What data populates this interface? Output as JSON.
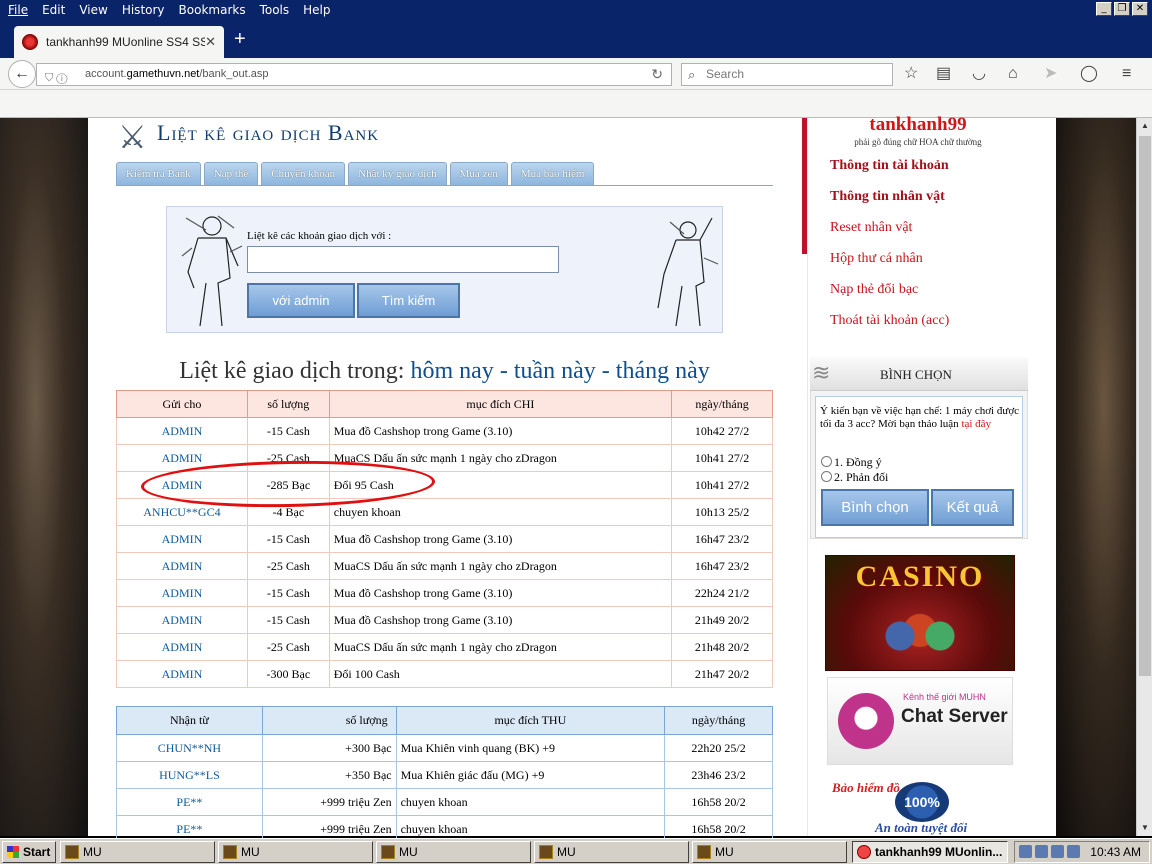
{
  "menubar": {
    "items": [
      "File",
      "Edit",
      "View",
      "History",
      "Bookmarks",
      "Tools",
      "Help"
    ]
  },
  "browser": {
    "tab_title": "tankhanh99 MUonline SS4 SS...",
    "url_prefix": "account.",
    "url_host": "gamethuvn.net",
    "url_path": "/bank_out.asp",
    "search_placeholder": "Search"
  },
  "page": {
    "title": "Liệt kê giao dịch Bank",
    "tabs": [
      "Kiểm tra Bank",
      "Nạp thẻ",
      "Chuyển khoản",
      "Nhật ký giao dịch",
      "Mua zen",
      "Mua bảo hiểm"
    ],
    "search_label": "Liệt kê các khoản giao dịch với :",
    "search_value": "",
    "btn_admin": "với admin",
    "btn_search": "Tìm kiếm",
    "list_heading_prefix": "Liệt kê giao dịch trong:",
    "list_today": "hôm nay",
    "list_week": "tuần này",
    "list_month": "tháng này",
    "sep": "-"
  },
  "chi_table": {
    "headers": [
      "Gửi cho",
      "số lượng",
      "mục đích CHI",
      "ngày/tháng"
    ],
    "rows": [
      [
        "ADMIN",
        "-15  Cash",
        "Mua đồ Cashshop trong Game (3.10)",
        "10h42 27/2"
      ],
      [
        "ADMIN",
        "-25  Cash",
        "MuaCS Dấu ấn sức mạnh 1 ngày cho zDragon",
        "10h41 27/2"
      ],
      [
        "ADMIN",
        "-285  Bạc",
        "Đổi 95 Cash",
        "10h41 27/2"
      ],
      [
        "ANHCU**GC4",
        "-4  Bạc",
        "chuyen khoan",
        "10h13 25/2"
      ],
      [
        "ADMIN",
        "-15  Cash",
        "Mua đồ Cashshop trong Game (3.10)",
        "16h47 23/2"
      ],
      [
        "ADMIN",
        "-25  Cash",
        "MuaCS Dấu ấn sức mạnh 1 ngày cho zDragon",
        "16h47 23/2"
      ],
      [
        "ADMIN",
        "-15  Cash",
        "Mua đồ Cashshop trong Game (3.10)",
        "22h24 21/2"
      ],
      [
        "ADMIN",
        "-15  Cash",
        "Mua đồ Cashshop trong Game (3.10)",
        "21h49 20/2"
      ],
      [
        "ADMIN",
        "-25  Cash",
        "MuaCS Dấu ấn sức mạnh 1 ngày cho zDragon",
        "21h48 20/2"
      ],
      [
        "ADMIN",
        "-300  Bạc",
        "Đổi 100 Cash",
        "21h47 20/2"
      ]
    ]
  },
  "thu_table": {
    "headers": [
      "Nhận từ",
      "số lượng",
      "mục đích THU",
      "ngày/tháng"
    ],
    "rows": [
      [
        "CHUN**NH",
        "+300  Bạc",
        "Mua Khiên vinh quang (BK) +9",
        "22h20 25/2"
      ],
      [
        "HUNG**LS",
        "+350  Bạc",
        "Mua Khiên giác đấu (MG) +9",
        "23h46 23/2"
      ],
      [
        "PE**",
        "+999  triệu Zen",
        "chuyen khoan",
        "16h58 20/2"
      ],
      [
        "PE**",
        "+999  triệu Zen",
        "chuyen khoan",
        "16h58 20/2"
      ]
    ]
  },
  "sidebar": {
    "username": "tankhanh99",
    "note": "phải gõ đúng chữ HOA chữ thường",
    "links": [
      "Thông tin tài khoản",
      "Thông tin nhân vật",
      "Reset nhân vật",
      "Hộp thư cá nhân",
      "Nạp thẻ đổi bạc",
      "Thoát tài khoản (acc)"
    ],
    "vote_title": "BÌNH CHỌN",
    "vote_question": "Ý kiến bạn về việc hạn chế: 1 máy chơi được tối đa 3 acc? Mời bạn thảo luận",
    "vote_link": "tại đây",
    "options": [
      "1. Đồng ý",
      "2. Phản đối"
    ],
    "btn_vote": "Bình chọn",
    "btn_result": "Kết quả",
    "ad_casino": "CASINO",
    "ad_chat_small": "Kênh thế giới MUHN",
    "ad_chat_big": "Chat Server",
    "ad_ins_top": "Bảo hiểm đồ",
    "ad_ins_seal": "100%",
    "ad_ins_bottom": "An toàn tuyệt đối"
  },
  "taskbar": {
    "start": "Start",
    "buttons": [
      "MU",
      "MU",
      "MU",
      "MU",
      "MU",
      "tankhanh99 MUonlin..."
    ],
    "clock": "10:43 AM"
  }
}
